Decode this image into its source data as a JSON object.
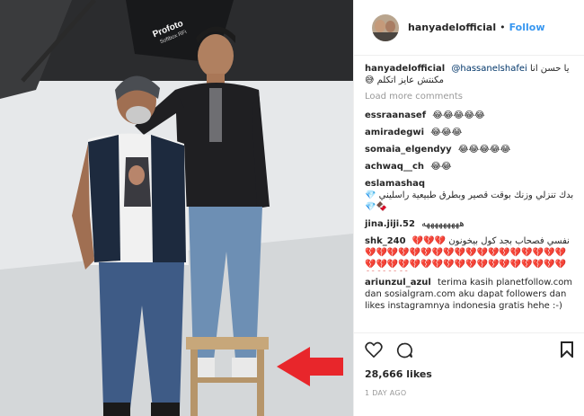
{
  "header": {
    "username": "hanyadelofficial",
    "separator": "•",
    "follow_label": "Follow"
  },
  "photo": {
    "softbox_brand": "Profoto",
    "softbox_model": "Softbox RFi"
  },
  "caption": {
    "username": "hanyadelofficial",
    "mention": "@hassanelshafei",
    "text_rtl": "يا حسن انا",
    "line2": "مكنتش عايز اتكلم 😅"
  },
  "load_more_label": "Load more comments",
  "comments": [
    {
      "user": "essraanasef",
      "text": "😂😂😂😂😂"
    },
    {
      "user": "amiradegwi",
      "text": "😂😂😂"
    },
    {
      "user": "somaia_elgendyy",
      "text": "😂😂😂😂😂"
    },
    {
      "user": "achwaq__ch",
      "text": "😂😂"
    },
    {
      "user": "eslamashaq",
      "text": "بدك تنزلي وزنك بوقت قصير وبطرق طبيعية راسليني 💎🍫💎"
    },
    {
      "user": "jina.jiji.52",
      "text": "هههههههههه"
    },
    {
      "user": "shk_240",
      "text": "نفسي فصحاب بجد كول بيخونون 💔💔💔💔💔💔💔💔💔💔💔💔💔💔💔💔💔💔💔💔💔💔💔💔💔💔💔💔💔💔💔💔💔💔💔💔💔💔💔💔💔💔💔"
    },
    {
      "user": "ariunzul_azul",
      "text": "terima kasih planetfollow.com dan sosialgram.com aku dapat followers dan likes instagramnya indonesia gratis hehe :-)"
    }
  ],
  "actions": {
    "likes": "28,666 likes",
    "date": "1 DAY AGO"
  },
  "colors": {
    "link": "#3897f0",
    "arrow": "#e8262b",
    "muted": "#999999"
  },
  "icons": [
    "heart-icon",
    "comment-icon",
    "bookmark-icon",
    "red-arrow"
  ]
}
